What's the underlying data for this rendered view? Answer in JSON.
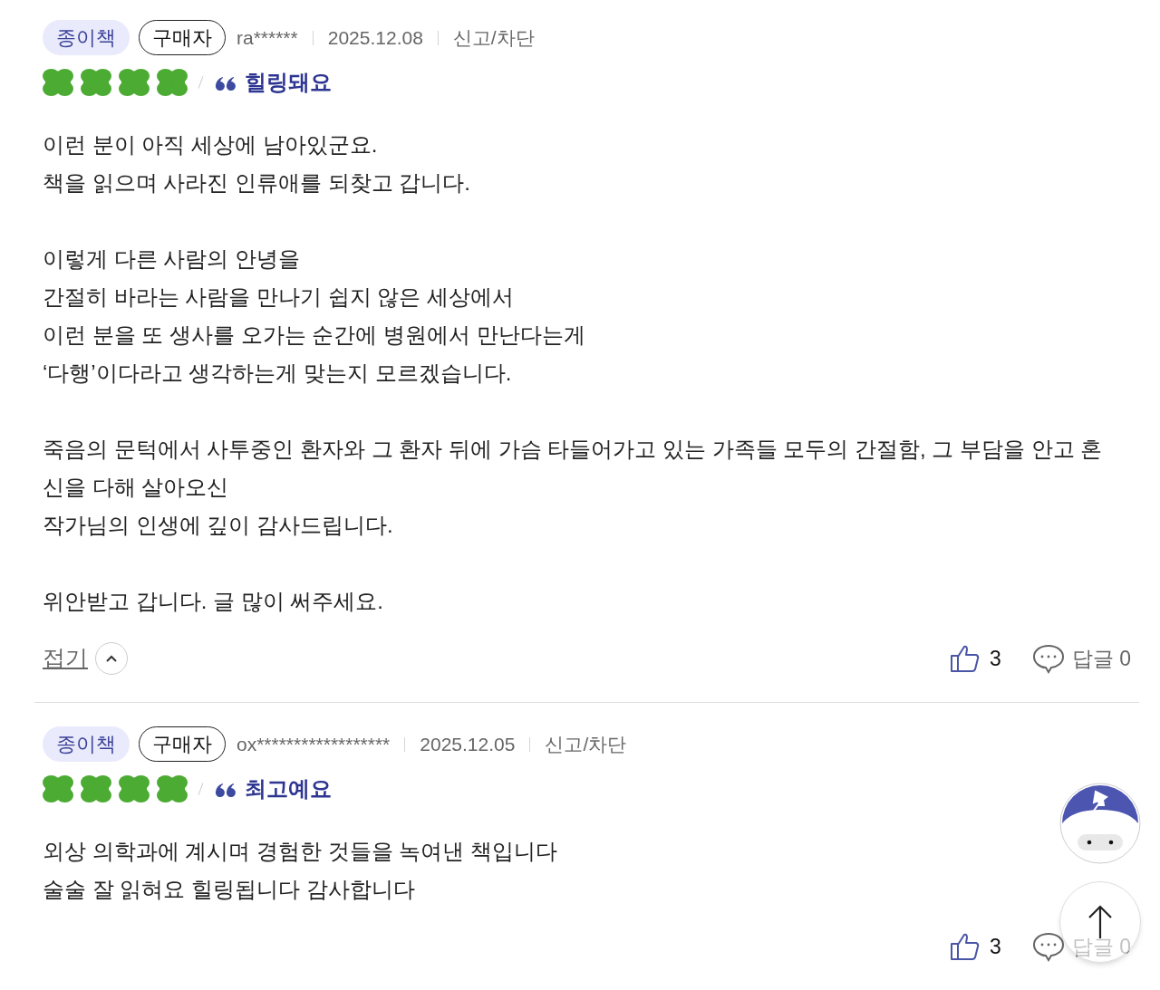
{
  "reviews": [
    {
      "format": "종이책",
      "badge": "구매자",
      "user": "ra******",
      "date": "2025.12.08",
      "report": "신고/차단",
      "stars": 4,
      "tag": "힐링돼요",
      "paragraphs": [
        [
          "이런 분이 아직 세상에 남아있군요.",
          "책을 읽으며 사라진 인류애를 되찾고 갑니다."
        ],
        [
          "이렇게 다른 사람의 안녕을",
          "간절히 바라는 사람을 만나기 쉽지 않은 세상에서",
          "이런 분을 또 생사를 오가는 순간에 병원에서 만난다는게",
          "‘다행’이다라고 생각하는게 맞는지 모르겠습니다."
        ],
        [
          "죽음의 문턱에서 사투중인 환자와 그 환자 뒤에 가슴 타들어가고 있는 가족들 모두의 간절함, 그 부담을 안고 혼신을 다해 살아오신",
          "작가님의 인생에 깊이 감사드립니다."
        ],
        [
          "위안받고 갑니다. 글 많이 써주세요."
        ]
      ],
      "collapse": "접기",
      "likes": "3",
      "replies": "답글 0"
    },
    {
      "format": "종이책",
      "badge": "구매자",
      "user": "ox******************",
      "date": "2025.12.05",
      "report": "신고/차단",
      "stars": 4,
      "tag": "최고예요",
      "paragraphs": [
        [
          "외상 의학과에 계시며 경험한 것들을 녹여낸 책입니다",
          "술술 잘 읽혀요 힐링됩니다 감사합니다"
        ]
      ],
      "likes": "3",
      "replies": "답글 0"
    }
  ]
}
